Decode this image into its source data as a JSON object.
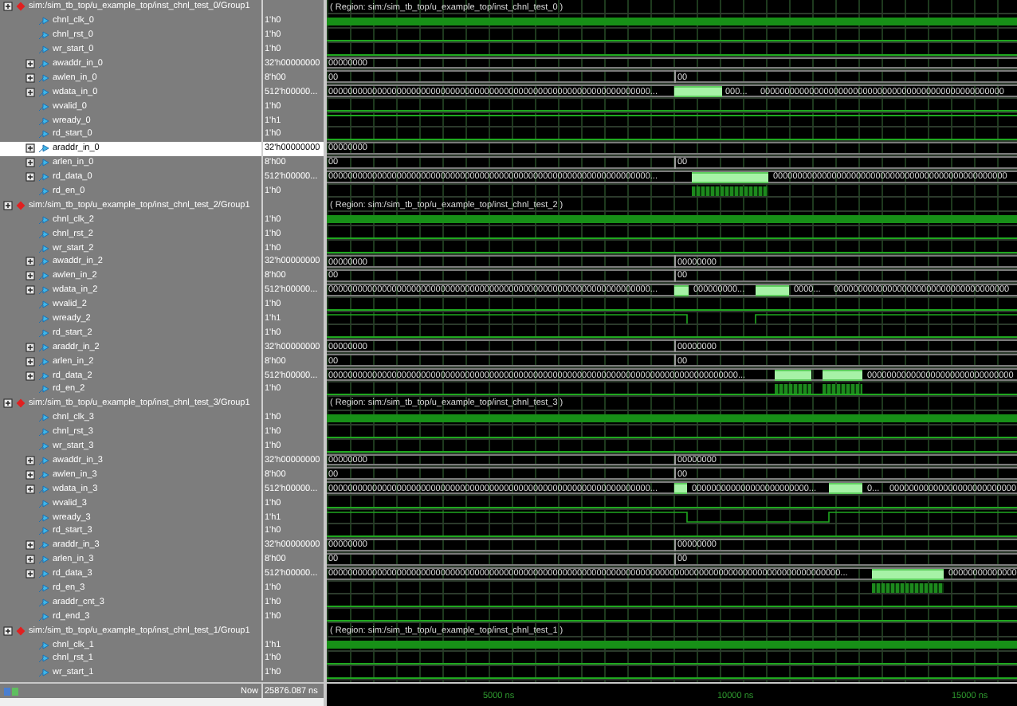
{
  "groups": [
    {
      "header": "sim:/sim_tb_top/u_example_top/inst_chnl_test_0/Group1",
      "region": "( Region: sim:/sim_tb_top/u_example_top/inst_chnl_test_0 )",
      "signals": [
        {
          "name": "chnl_clk_0",
          "value": "1'h0",
          "kind": "clock",
          "selected": false
        },
        {
          "name": "chnl_rst_0",
          "value": "1'h0",
          "kind": "low",
          "selected": false
        },
        {
          "name": "wr_start_0",
          "value": "1'h0",
          "kind": "low",
          "selected": false
        },
        {
          "name": "awaddr_in_0",
          "value": "32'h00000000",
          "kind": "bus",
          "selected": false,
          "wave_labels": [
            "00000000"
          ]
        },
        {
          "name": "awlen_in_0",
          "value": "8'h00",
          "kind": "bus",
          "selected": false,
          "wave_labels": [
            "00",
            "00"
          ]
        },
        {
          "name": "wdata_in_0",
          "value": "512'h00000...",
          "kind": "data",
          "selected": false,
          "wave_labels": [
            "000000000000000000000000000000000000000000000000000000000000000000...",
            "000...",
            "00000000000000000000000000000000000000000000000000"
          ]
        },
        {
          "name": "wvalid_0",
          "value": "1'h0",
          "kind": "low",
          "selected": false
        },
        {
          "name": "wready_0",
          "value": "1'h1",
          "kind": "high",
          "selected": false
        },
        {
          "name": "rd_start_0",
          "value": "1'h0",
          "kind": "low",
          "selected": false
        },
        {
          "name": "araddr_in_0",
          "value": "32'h00000000",
          "kind": "bus",
          "selected": true,
          "wave_labels": [
            "00000000"
          ]
        },
        {
          "name": "arlen_in_0",
          "value": "8'h00",
          "kind": "bus",
          "selected": false,
          "wave_labels": [
            "00",
            "00"
          ]
        },
        {
          "name": "rd_data_0",
          "value": "512'h00000...",
          "kind": "data",
          "selected": false,
          "wave_labels": [
            "000000000000000000000000000000000000000000000000000000000000000000...",
            "000000000000000000000000000000000000000000000000"
          ]
        },
        {
          "name": "rd_en_0",
          "value": "1'h0",
          "kind": "strobe",
          "selected": false
        }
      ]
    },
    {
      "header": "sim:/sim_tb_top/u_example_top/inst_chnl_test_2/Group1",
      "region": "( Region: sim:/sim_tb_top/u_example_top/inst_chnl_test_2 )",
      "signals": [
        {
          "name": "chnl_clk_2",
          "value": "1'h0",
          "kind": "clock",
          "selected": false
        },
        {
          "name": "chnl_rst_2",
          "value": "1'h0",
          "kind": "low",
          "selected": false
        },
        {
          "name": "wr_start_2",
          "value": "1'h0",
          "kind": "low",
          "selected": false
        },
        {
          "name": "awaddr_in_2",
          "value": "32'h00000000",
          "kind": "bus",
          "selected": false,
          "wave_labels": [
            "00000000",
            "00000000"
          ]
        },
        {
          "name": "awlen_in_2",
          "value": "8'h00",
          "kind": "bus",
          "selected": false,
          "wave_labels": [
            "00",
            "00"
          ]
        },
        {
          "name": "wdata_in_2",
          "value": "512'h00000...",
          "kind": "data",
          "selected": false,
          "wave_labels": [
            "000000000000000000000000000000000000000000000000000000000000000000...",
            "000000000...",
            "0000...",
            "000000000000000000000000000000000000"
          ]
        },
        {
          "name": "wvalid_2",
          "value": "1'h0",
          "kind": "low",
          "selected": false
        },
        {
          "name": "wready_2",
          "value": "1'h1",
          "kind": "ready",
          "selected": false
        },
        {
          "name": "rd_start_2",
          "value": "1'h0",
          "kind": "low",
          "selected": false
        },
        {
          "name": "araddr_in_2",
          "value": "32'h00000000",
          "kind": "bus",
          "selected": false,
          "wave_labels": [
            "00000000",
            "00000000"
          ]
        },
        {
          "name": "arlen_in_2",
          "value": "8'h00",
          "kind": "bus",
          "selected": false,
          "wave_labels": [
            "00",
            "00"
          ]
        },
        {
          "name": "rd_data_2",
          "value": "512'h00000...",
          "kind": "data",
          "selected": false,
          "wave_labels": [
            "000000000000000000000000000000000000000000000000000000000000000000000000000000000000...",
            "000000000000000000000000000000"
          ]
        },
        {
          "name": "rd_en_2",
          "value": "1'h0",
          "kind": "strobe",
          "selected": false
        }
      ]
    },
    {
      "header": "sim:/sim_tb_top/u_example_top/inst_chnl_test_3/Group1",
      "region": "( Region: sim:/sim_tb_top/u_example_top/inst_chnl_test_3 )",
      "signals": [
        {
          "name": "chnl_clk_3",
          "value": "1'h0",
          "kind": "clock",
          "selected": false
        },
        {
          "name": "chnl_rst_3",
          "value": "1'h0",
          "kind": "low",
          "selected": false
        },
        {
          "name": "wr_start_3",
          "value": "1'h0",
          "kind": "low",
          "selected": false
        },
        {
          "name": "awaddr_in_3",
          "value": "32'h00000000",
          "kind": "bus",
          "selected": false,
          "wave_labels": [
            "00000000",
            "00000000"
          ]
        },
        {
          "name": "awlen_in_3",
          "value": "8'h00",
          "kind": "bus",
          "selected": false,
          "wave_labels": [
            "00",
            "00"
          ]
        },
        {
          "name": "wdata_in_3",
          "value": "512'h00000...",
          "kind": "data",
          "selected": false,
          "wave_labels": [
            "000000000000000000000000000000000000000000000000000000000000000000...",
            "000000000000000000000000...",
            "0...",
            "00000000000000000000000000"
          ]
        },
        {
          "name": "wvalid_3",
          "value": "1'h0",
          "kind": "low",
          "selected": false
        },
        {
          "name": "wready_3",
          "value": "1'h1",
          "kind": "ready",
          "selected": false
        },
        {
          "name": "rd_start_3",
          "value": "1'h0",
          "kind": "low",
          "selected": false
        },
        {
          "name": "araddr_in_3",
          "value": "32'h00000000",
          "kind": "bus",
          "selected": false,
          "wave_labels": [
            "00000000",
            "00000000"
          ]
        },
        {
          "name": "arlen_in_3",
          "value": "8'h00",
          "kind": "bus",
          "selected": false,
          "wave_labels": [
            "00",
            "00"
          ]
        },
        {
          "name": "rd_data_3",
          "value": "512'h00000...",
          "kind": "data",
          "selected": false,
          "wave_labels": [
            "000000000000000000000000000000000000000000000000000000000000000000000000000000000000000000000000000000000...",
            "00000000000000"
          ]
        },
        {
          "name": "rd_en_3",
          "value": "1'h0",
          "kind": "strobe",
          "selected": false
        },
        {
          "name": "araddr_cnt_3",
          "value": "1'h0",
          "kind": "low",
          "selected": false
        },
        {
          "name": "rd_end_3",
          "value": "1'h0",
          "kind": "low",
          "selected": false
        }
      ]
    },
    {
      "header": "sim:/sim_tb_top/u_example_top/inst_chnl_test_1/Group1",
      "region": "( Region: sim:/sim_tb_top/u_example_top/inst_chnl_test_1 )",
      "signals": [
        {
          "name": "chnl_clk_1",
          "value": "1'h1",
          "kind": "clock",
          "selected": false
        },
        {
          "name": "chnl_rst_1",
          "value": "1'h0",
          "kind": "low",
          "selected": false
        },
        {
          "name": "wr_start_1",
          "value": "1'h0",
          "kind": "low",
          "selected": false
        }
      ]
    }
  ],
  "status": {
    "now_label": "Now",
    "now_value": "25876.087 ns"
  },
  "timeline": {
    "ticks": [
      "5000 ns",
      "10000 ns",
      "15000 ns"
    ]
  }
}
